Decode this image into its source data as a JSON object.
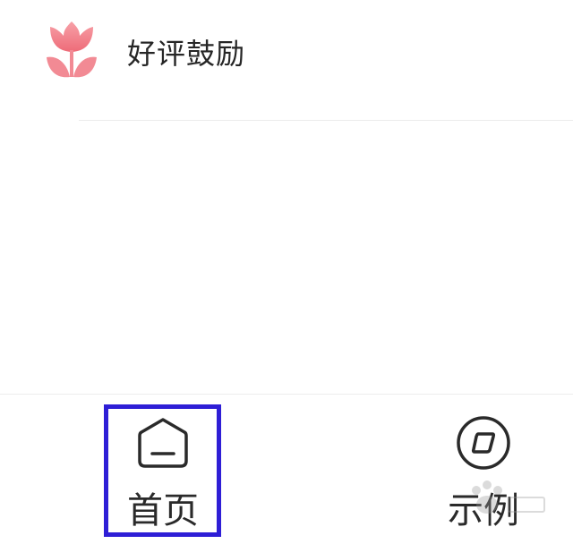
{
  "list": {
    "items": [
      {
        "label": "好评鼓励",
        "icon": "flower-icon",
        "icon_color": "#f2707c"
      }
    ]
  },
  "tabbar": {
    "tabs": [
      {
        "label": "首页",
        "icon": "home-icon",
        "active": true
      },
      {
        "label": "示例",
        "icon": "example-icon",
        "active": false
      }
    ]
  },
  "colors": {
    "highlight": "#2e1ed6",
    "text": "#262626",
    "divider": "#ececec"
  }
}
